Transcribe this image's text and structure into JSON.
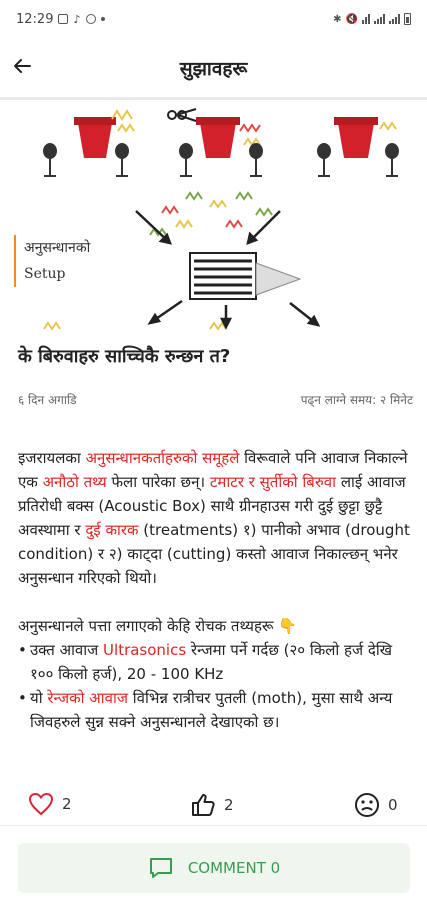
{
  "status_bar": {
    "time": "12:29"
  },
  "app_bar": {
    "title": "सुझावहरू",
    "back_icon": "arrow-left-icon"
  },
  "hero": {
    "label_line1": "अनुसन्धानको",
    "label_line2": "Setup"
  },
  "article": {
    "title": "के बिरुवाहरु साच्चिकै रुन्छन त?",
    "posted": "६ दिन अगाडि",
    "read_time": "पढ्न लाग्ने समय: २ मिनेट",
    "p1": {
      "t1": "इजरायलका ",
      "h1": "अनुसन्धानकर्ताहरुको समूहले",
      "t2": " विरूवाले पनि आवाज निकाल्ने एक ",
      "h2": "अनौठो तथ्य",
      "t3": " फेला पारेका छन्। ",
      "h3": "टमाटर र सुर्तीको बिरुवा",
      "t4": " लाई आवाज प्रतिरोधी बक्स (Acoustic Box) साथै ग्रीनहाउस गरी दुई छुट्टा छुट्टै अवस्थामा र ",
      "h4": "दुई कारक",
      "t5": " (treatments) १) पानीको अभाव (drought condition) र २) काट्दा (cutting) कस्तो आवाज निकाल्छन् भनेर अनुसन्धान गरिएको थियो।"
    },
    "p2_intro": "अनुसन्धानले पत्ता लगाएको केहि रोचक तथ्यहरू 👇",
    "bullet1": {
      "t1": "उक्त आवाज ",
      "h1": "Ultrasonics",
      "t2": " रेन्जमा पर्ने गर्दछ (२० किलो हर्ज देखि १०० किलो हर्ज), 20 - 100 KHz"
    },
    "bullet2": {
      "t1": "यो ",
      "h1": "रेन्जको आवाज",
      "t2": " विभिन्न रात्रीचर पुतली (moth), मुसा साथै अन्य जिवहरुले सुन्न सक्ने अनुसन्धानले देखाएको छ।"
    }
  },
  "reactions": {
    "like_icon": "heart-icon",
    "like_count": "2",
    "thumb_icon": "thumbs-up-icon",
    "thumb_count": "2",
    "meh_icon": "neutral-face-icon",
    "meh_count": "0"
  },
  "comment": {
    "label": "COMMENT 0",
    "icon": "comment-icon"
  },
  "colors": {
    "highlight": "#e02424",
    "accent_green": "#3c9a51",
    "label_bar": "#f08a2c"
  }
}
